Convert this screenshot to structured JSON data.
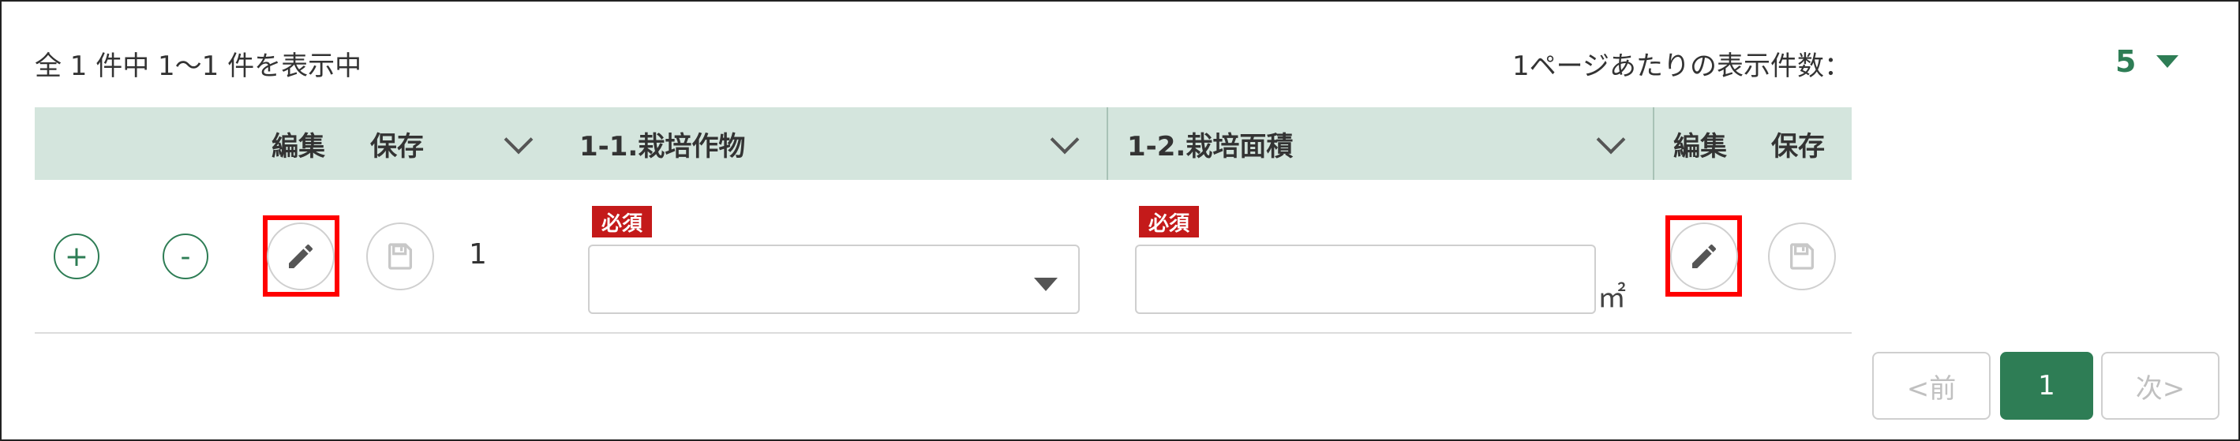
{
  "summary": "全 1 件中 1～1 件を表示中",
  "per_page": {
    "label": "1ページあたりの表示件数：",
    "value": "5"
  },
  "header": {
    "col1_edit": "編集",
    "col1_save": "保存",
    "crop": "1-1.栽培作物",
    "area": "1-2.栽培面積",
    "col2_edit": "編集",
    "col2_save": "保存"
  },
  "row": {
    "add_label": "+",
    "remove_label": "-",
    "number": "1",
    "crop_required": "必須",
    "crop_value": "",
    "area_required": "必須",
    "area_value": "",
    "area_unit": "㎡"
  },
  "pager": {
    "prev": "<前",
    "current": "1",
    "next": "次>"
  },
  "colors": {
    "accent": "#2e7d55",
    "header_bg": "#d4e5dd",
    "required": "#c41a1a",
    "highlight": "#ff0000"
  }
}
